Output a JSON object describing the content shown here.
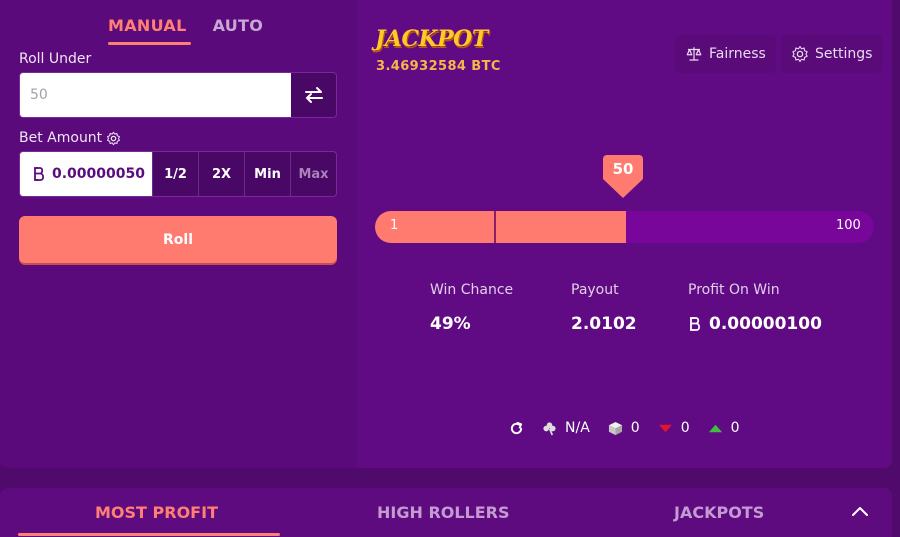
{
  "mode_tabs": {
    "manual": "MANUAL",
    "auto": "AUTO"
  },
  "roll_under": {
    "label": "Roll Under",
    "value": "50"
  },
  "bet": {
    "label": "Bet Amount",
    "amount": "0.00000050",
    "half": "1/2",
    "double": "2X",
    "min": "Min",
    "max": "Max"
  },
  "roll_button": "Roll",
  "jackpot": {
    "logo": "JACKPOT",
    "amount": "3.46932584 BTC"
  },
  "header": {
    "fairness": "Fairness",
    "settings": "Settings"
  },
  "slider": {
    "value": 50,
    "marker": "50",
    "min": "1",
    "max": "100",
    "divider_value": 25
  },
  "stats": {
    "win_chance": {
      "label": "Win Chance",
      "value": "49%"
    },
    "payout": {
      "label": "Payout",
      "value": "2.0102"
    },
    "profit": {
      "label": "Profit On Win",
      "value": "0.00000100"
    }
  },
  "session": {
    "luck": "N/A",
    "bets": "0",
    "losses": "0",
    "wins": "0"
  },
  "bottom_tabs": {
    "most_profit": "MOST PROFIT",
    "high_rollers": "HIGH ROLLERS",
    "jackpots": "JACKPOTS"
  },
  "colors": {
    "accent": "#ff7b70",
    "panel": "#5c0b7e",
    "gold": "#ffc928"
  }
}
